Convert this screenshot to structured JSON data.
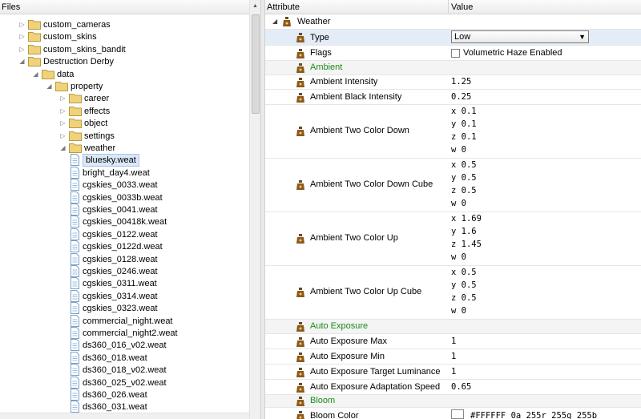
{
  "files_header": "Files",
  "tree": [
    {
      "label": "custom_cameras",
      "depth": 1,
      "kind": "folder",
      "tri": "▷"
    },
    {
      "label": "custom_skins",
      "depth": 1,
      "kind": "folder",
      "tri": "▷"
    },
    {
      "label": "custom_skins_bandit",
      "depth": 1,
      "kind": "folder",
      "tri": "▷"
    },
    {
      "label": "Destruction Derby",
      "depth": 1,
      "kind": "folder",
      "tri": "◢"
    },
    {
      "label": "data",
      "depth": 2,
      "kind": "folder",
      "tri": "◢"
    },
    {
      "label": "property",
      "depth": 3,
      "kind": "folder",
      "tri": "◢"
    },
    {
      "label": "career",
      "depth": 4,
      "kind": "folder",
      "tri": "▷"
    },
    {
      "label": "effects",
      "depth": 4,
      "kind": "folder",
      "tri": "▷"
    },
    {
      "label": "object",
      "depth": 4,
      "kind": "folder",
      "tri": "▷"
    },
    {
      "label": "settings",
      "depth": 4,
      "kind": "folder",
      "tri": "▷"
    },
    {
      "label": "weather",
      "depth": 4,
      "kind": "folder",
      "tri": "◢"
    },
    {
      "label": "bluesky.weat",
      "depth": 5,
      "kind": "file",
      "selected": true
    },
    {
      "label": "bright_day4.weat",
      "depth": 5,
      "kind": "file"
    },
    {
      "label": "cgskies_0033.weat",
      "depth": 5,
      "kind": "file"
    },
    {
      "label": "cgskies_0033b.weat",
      "depth": 5,
      "kind": "file"
    },
    {
      "label": "cgskies_0041.weat",
      "depth": 5,
      "kind": "file"
    },
    {
      "label": "cgskies_00418k.weat",
      "depth": 5,
      "kind": "file"
    },
    {
      "label": "cgskies_0122.weat",
      "depth": 5,
      "kind": "file"
    },
    {
      "label": "cgskies_0122d.weat",
      "depth": 5,
      "kind": "file"
    },
    {
      "label": "cgskies_0128.weat",
      "depth": 5,
      "kind": "file"
    },
    {
      "label": "cgskies_0246.weat",
      "depth": 5,
      "kind": "file"
    },
    {
      "label": "cgskies_0311.weat",
      "depth": 5,
      "kind": "file"
    },
    {
      "label": "cgskies_0314.weat",
      "depth": 5,
      "kind": "file"
    },
    {
      "label": "cgskies_0323.weat",
      "depth": 5,
      "kind": "file"
    },
    {
      "label": "commercial_night.weat",
      "depth": 5,
      "kind": "file"
    },
    {
      "label": "commercial_night2.weat",
      "depth": 5,
      "kind": "file"
    },
    {
      "label": "ds360_016_v02.weat",
      "depth": 5,
      "kind": "file"
    },
    {
      "label": "ds360_018.weat",
      "depth": 5,
      "kind": "file"
    },
    {
      "label": "ds360_018_v02.weat",
      "depth": 5,
      "kind": "file"
    },
    {
      "label": "ds360_025_v02.weat",
      "depth": 5,
      "kind": "file"
    },
    {
      "label": "ds360_026.weat",
      "depth": 5,
      "kind": "file"
    },
    {
      "label": "ds360_031.weat",
      "depth": 5,
      "kind": "file"
    }
  ],
  "attr_header": "Attribute",
  "value_header": "Value",
  "props": {
    "root": "Weather",
    "type_label": "Type",
    "type_value": "Low",
    "flags_label": "Flags",
    "flags_value": "Volumetric Haze Enabled",
    "ambient_group": "Ambient",
    "ambient_intensity": {
      "label": "Ambient Intensity",
      "value": "1.25"
    },
    "ambient_black": {
      "label": "Ambient Black Intensity",
      "value": "0.25"
    },
    "two_down": {
      "label": "Ambient Two Color Down",
      "x": "x 0.1",
      "y": "y 0.1",
      "z": "z 0.1",
      "w": "w 0"
    },
    "two_down_cube": {
      "label": "Ambient Two Color Down Cube",
      "x": "x 0.5",
      "y": "y 0.5",
      "z": "z 0.5",
      "w": "w 0"
    },
    "two_up": {
      "label": "Ambient Two Color Up",
      "x": "x 1.69",
      "y": "y 1.6",
      "z": "z 1.45",
      "w": "w 0"
    },
    "two_up_cube": {
      "label": "Ambient Two Color Up Cube",
      "x": "x 0.5",
      "y": "y 0.5",
      "z": "z 0.5",
      "w": "w 0"
    },
    "auto_group": "Auto Exposure",
    "ae_max": {
      "label": "Auto Exposure Max",
      "value": "1"
    },
    "ae_min": {
      "label": "Auto Exposure Min",
      "value": "1"
    },
    "ae_target": {
      "label": "Auto Exposure Target Luminance",
      "value": "1"
    },
    "ae_speed": {
      "label": "Auto Exposure Adaptation Speed",
      "value": "0.65"
    },
    "bloom_group": "Bloom",
    "bloom_color": {
      "label": "Bloom Color",
      "value": "#FFFFFF      0a  255r  255g  255b"
    }
  },
  "colors": {
    "group_text": "#1b8a1b",
    "selection": "#dbe8f7",
    "folder": "#f0d27a"
  }
}
